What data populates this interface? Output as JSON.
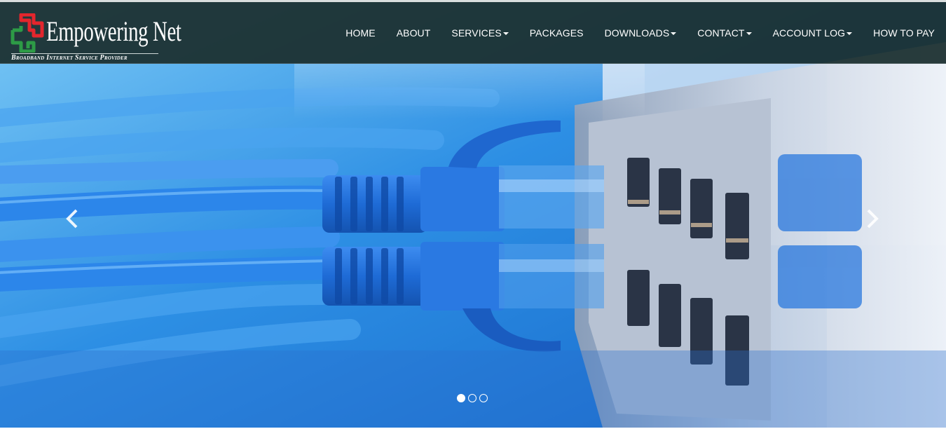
{
  "brand": {
    "name": "Empowering Net",
    "tagline": "Broadband Internet Service Provider",
    "colors": {
      "red": "#e3262d",
      "green": "#2d9b46"
    }
  },
  "nav": {
    "items": [
      {
        "label": "HOME",
        "dropdown": false
      },
      {
        "label": "ABOUT",
        "dropdown": false
      },
      {
        "label": "SERVICES",
        "dropdown": true
      },
      {
        "label": "PACKAGES",
        "dropdown": false
      },
      {
        "label": "DOWNLOADS",
        "dropdown": true
      },
      {
        "label": "CONTACT",
        "dropdown": true
      },
      {
        "label": "ACCOUNT LOG",
        "dropdown": true
      },
      {
        "label": "HOW TO PAY",
        "dropdown": false
      }
    ]
  },
  "carousel": {
    "prev_icon": "chevron-left-icon",
    "next_icon": "chevron-right-icon",
    "slide_count": 3,
    "active_slide": 1,
    "image": "blue ethernet cables plugged into network switch"
  },
  "colors": {
    "header_bg": "#1c3030",
    "cable_blue": "#1f6fd8",
    "switch_grey": "#a9b4c4"
  }
}
